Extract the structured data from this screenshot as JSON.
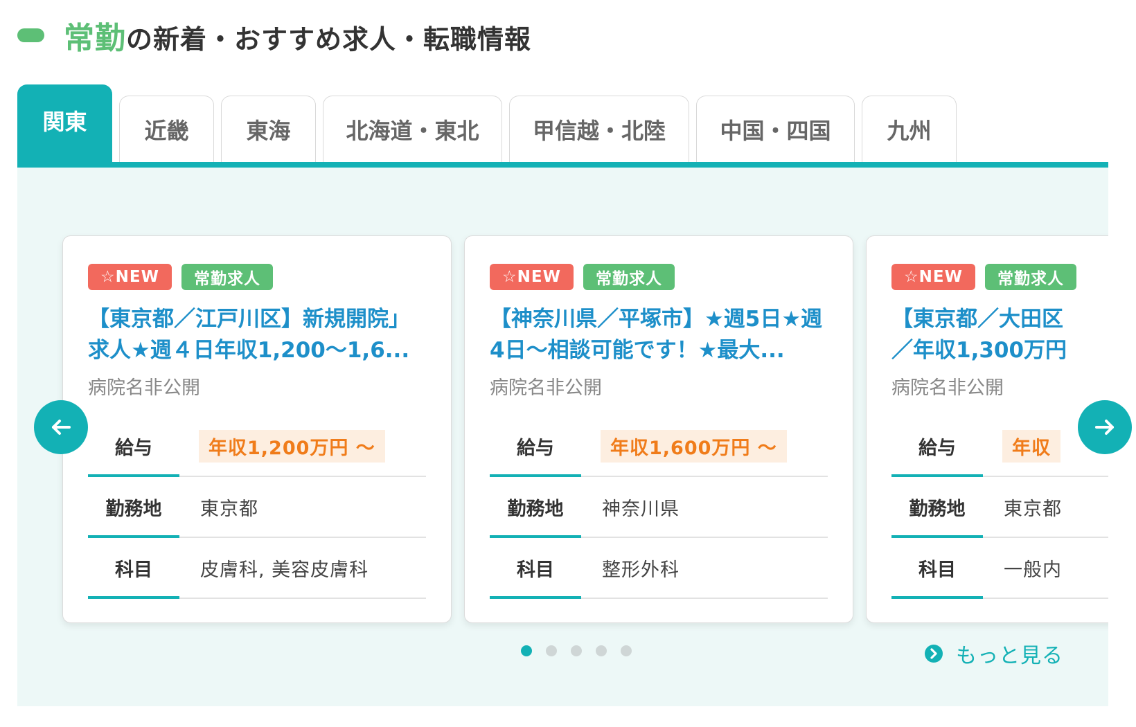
{
  "heading": {
    "accent": "常勤",
    "title": "の新着・おすすめ求人・転職情報"
  },
  "tabs": [
    {
      "label": "関東",
      "active": true
    },
    {
      "label": "近畿",
      "active": false
    },
    {
      "label": "東海",
      "active": false
    },
    {
      "label": "北海道・東北",
      "active": false
    },
    {
      "label": "甲信越・北陸",
      "active": false
    },
    {
      "label": "中国・四国",
      "active": false
    },
    {
      "label": "九州",
      "active": false
    }
  ],
  "labels": {
    "salary": "給与",
    "location": "勤務地",
    "department": "科目"
  },
  "cards": [
    {
      "badge_new": "☆NEW",
      "badge_type": "常勤求人",
      "title": "【東京都／江戸川区】新規開院」求人★週４日年収1,200〜1,6...",
      "hospital": "病院名非公開",
      "salary": "年収1,200万円 〜",
      "location": "東京都",
      "department": "皮膚科, 美容皮膚科"
    },
    {
      "badge_new": "☆NEW",
      "badge_type": "常勤求人",
      "title": "【神奈川県／平塚市】★週5日★週4日〜相談可能です！★最大...",
      "hospital": "病院名非公開",
      "salary": "年収1,600万円 〜",
      "location": "神奈川県",
      "department": "整形外科"
    },
    {
      "badge_new": "☆NEW",
      "badge_type": "常勤求人",
      "title": "【東京都／大田区",
      "title_line2": "／年収1,300万円",
      "hospital": "病院名非公開",
      "salary": "年収",
      "location": "東京都",
      "department": "一般内"
    }
  ],
  "pagination": {
    "count": 5,
    "current": 0
  },
  "more_link": "もっと見る",
  "colors": {
    "accent_teal": "#13b1b5",
    "accent_green": "#5dbf76",
    "badge_new_red": "#f2695d",
    "title_blue": "#1d8fc9",
    "salary_orange": "#f07c1a",
    "panel_bg": "#edf8f7"
  },
  "icons": {
    "prev": "arrow-left-icon",
    "next": "arrow-right-icon",
    "more": "chevron-circle-right-icon"
  }
}
